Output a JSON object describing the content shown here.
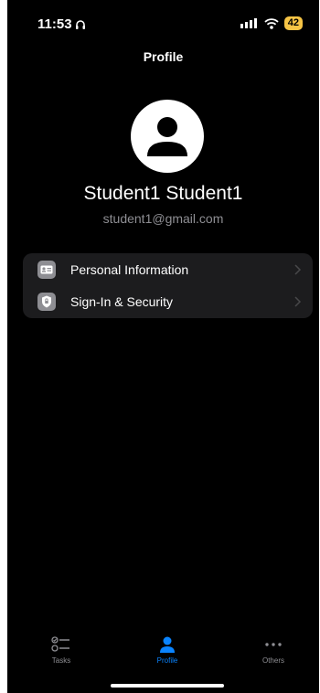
{
  "status_bar": {
    "time": "11:53",
    "battery": "42",
    "battery_color": "#f6c445"
  },
  "header": {
    "title": "Profile"
  },
  "profile": {
    "name": "Student1 Student1",
    "email": "student1@gmail.com",
    "avatar_icon": "person-icon"
  },
  "menu": {
    "items": [
      {
        "label": "Personal Information",
        "icon": "id-card-icon"
      },
      {
        "label": "Sign-In & Security",
        "icon": "shield-icon"
      }
    ]
  },
  "tabs": [
    {
      "label": "Tasks",
      "icon": "checklist-icon",
      "active": false
    },
    {
      "label": "Profile",
      "icon": "person-icon",
      "active": true
    },
    {
      "label": "Others",
      "icon": "ellipsis-icon",
      "active": false
    }
  ],
  "colors": {
    "background": "#000000",
    "card": "#1c1c1e",
    "accent": "#0a84ff",
    "secondary_text": "#8e8e93"
  }
}
